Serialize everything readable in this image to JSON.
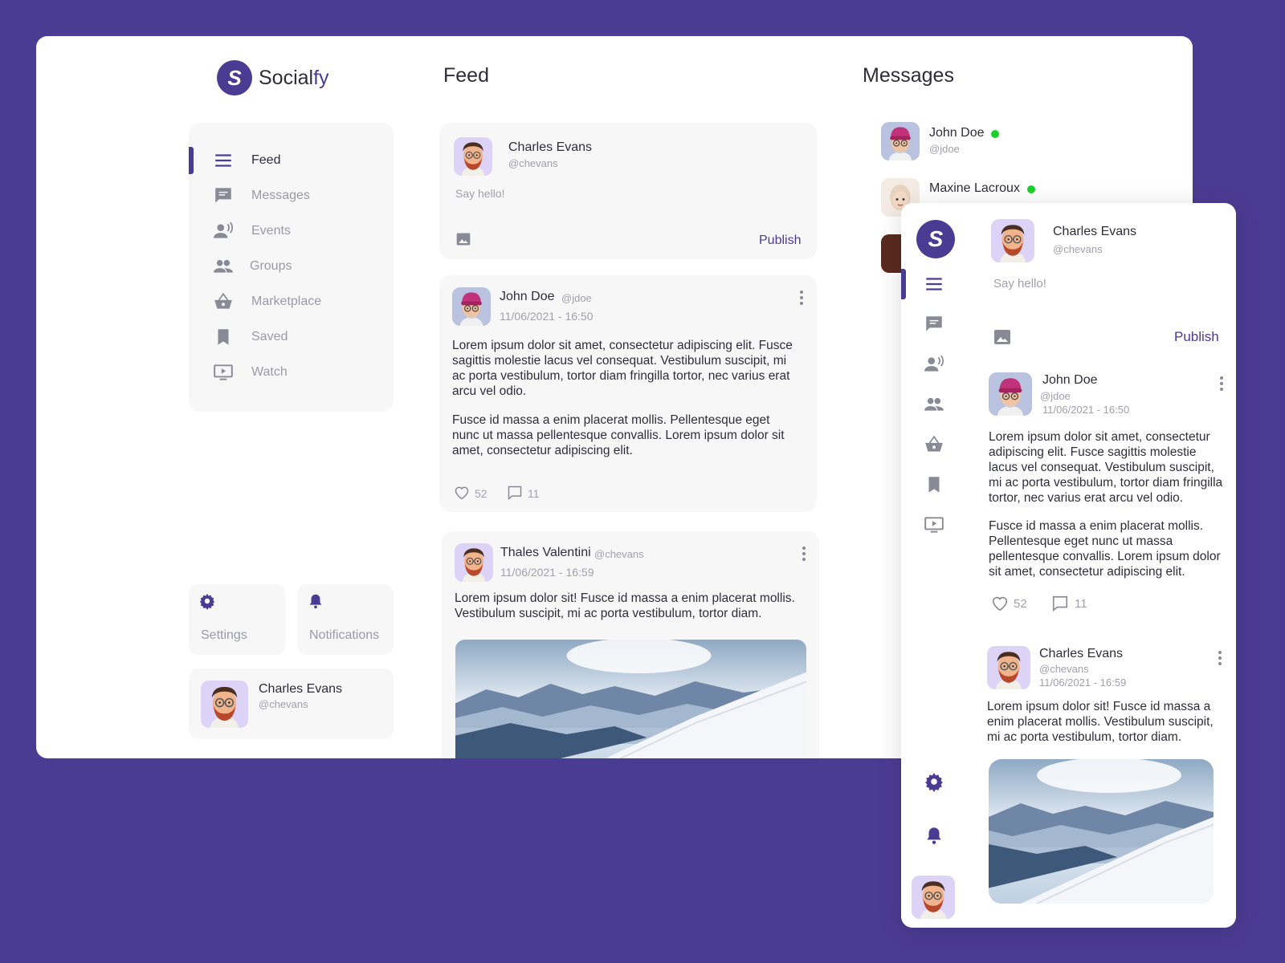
{
  "app": {
    "name_main": "Social",
    "name_accent": "fy",
    "logo_letter": "S"
  },
  "colors": {
    "accent": "#4b3c93",
    "background": "#4b3c93",
    "surface": "#f7f7f8",
    "online": "#19d12a"
  },
  "columns": {
    "feed_title": "Feed",
    "messages_title": "Messages"
  },
  "sidebar": {
    "items": [
      {
        "label": "Feed",
        "icon": "menu-icon",
        "active": true
      },
      {
        "label": "Messages",
        "icon": "chat-icon"
      },
      {
        "label": "Events",
        "icon": "events-icon"
      },
      {
        "label": "Groups",
        "icon": "groups-icon"
      },
      {
        "label": "Marketplace",
        "icon": "basket-icon"
      },
      {
        "label": "Saved",
        "icon": "bookmark-icon"
      },
      {
        "label": "Watch",
        "icon": "video-icon"
      }
    ],
    "settings_label": "Settings",
    "notifications_label": "Notifications"
  },
  "current_user": {
    "name": "Charles Evans",
    "handle": "@chevans"
  },
  "composer": {
    "placeholder": "Say hello!",
    "publish_label": "Publish"
  },
  "posts": [
    {
      "author": "John Doe",
      "handle": "@jdoe",
      "timestamp": "11/06/2021 - 16:50",
      "paragraphs": [
        "Lorem ipsum dolor sit amet, consectetur adipiscing elit. Fusce sagittis molestie lacus vel consequat. Vestibulum suscipit, mi ac porta vestibulum, tortor diam fringilla tortor, nec varius erat arcu vel odio.",
        "Fusce id massa a enim placerat mollis. Pellentesque eget nunc ut massa pellentesque convallis. Lorem ipsum dolor sit amet, consectetur adipiscing elit."
      ],
      "likes": "52",
      "comments": "11"
    },
    {
      "author": "Thales Valentini",
      "handle": "@chevans",
      "timestamp": "11/06/2021 - 16:59",
      "paragraphs": [
        "Lorem ipsum dolor sit! Fusce id massa a enim placerat mollis. Vestibulum suscipit, mi ac porta vestibulum, tortor diam."
      ],
      "image": "snowy-mountain-photo"
    }
  ],
  "messages": [
    {
      "name": "John Doe",
      "handle": "@jdoe",
      "online": true
    },
    {
      "name": "Maxine Lacroux",
      "online": true
    }
  ],
  "mobile": {
    "composer_user": {
      "name": "Charles Evans",
      "handle": "@chevans"
    },
    "placeholder": "Say hello!",
    "publish_label": "Publish",
    "post1": {
      "author": "John Doe",
      "handle": "@jdoe",
      "timestamp": "11/06/2021 - 16:50",
      "paragraphs": [
        "Lorem ipsum dolor sit amet, consectetur adipiscing elit. Fusce sagittis molestie lacus vel consequat. Vestibulum suscipit, mi ac porta vestibulum, tortor diam fringilla tortor, nec varius erat arcu vel odio.",
        "Fusce id massa a enim placerat mollis. Pellentesque eget nunc ut massa pellentesque convallis. Lorem ipsum dolor sit amet, consectetur adipiscing elit."
      ],
      "likes": "52",
      "comments": "11"
    },
    "post2": {
      "author": "Charles Evans",
      "handle": "@chevans",
      "timestamp": "11/06/2021 - 16:59",
      "paragraph": "Lorem ipsum dolor sit! Fusce id massa a enim placerat mollis. Vestibulum suscipit, mi ac porta vestibulum, tortor diam."
    }
  }
}
